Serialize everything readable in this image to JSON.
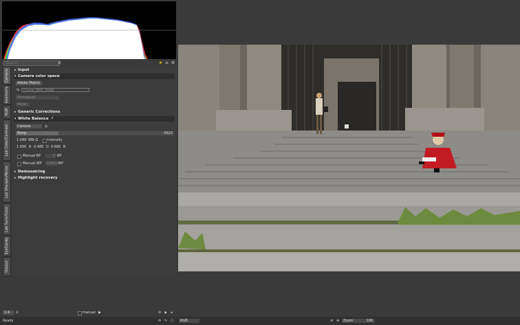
{
  "search": {
    "placeholder": "Search"
  },
  "tabs": [
    "Camera",
    "Geometry",
    "RGB",
    "Lab Color/Contrast",
    "Lab Sharpen/Noise",
    "Lab Sync/Color",
    "EyeCandy",
    "Output"
  ],
  "modules": {
    "input": "Input",
    "camera_color_space": "Camera color space",
    "color_matrix_value": "Adobe Matrix",
    "camera_profile_value": "Canon_EOS_500D",
    "intent_value": "Perceptual",
    "none_value": "None",
    "generic_corrections": "Generic Corrections",
    "white_balance": "White Balance",
    "wb_method_value": "Camera",
    "temp_label": "Temp",
    "temp_value": "5623",
    "wbg_value": "1.049",
    "wbg_label": "WB-G",
    "intensity_label": "Intensity",
    "r_value": "1.000",
    "r_label": "R",
    "g_value": "0.485",
    "g_label": "G",
    "b_value": "0.680",
    "b_label": "B",
    "manual_bp_label": "Manual BP",
    "bp_value": "0",
    "bp_label": "BP",
    "manual_wp_label": "Manual WP",
    "wp_value": "13433",
    "wp_label": "WP",
    "demosaicing": "Demosaicing",
    "highlight_recovery": "Highlight recovery"
  },
  "footer": {
    "zoom_ratio": "1:4",
    "mode_value": "manual",
    "status": "Ready",
    "colorspace": "RGB",
    "zoom_label": "Zoom",
    "zoom_value": "106"
  },
  "colors": {
    "accent_star": "#f0c020",
    "background": "#3a3a3a",
    "histogram_bg": "#000000"
  }
}
